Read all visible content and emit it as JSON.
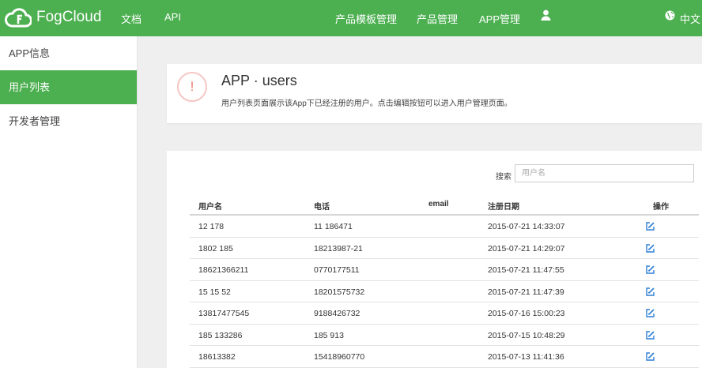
{
  "header": {
    "brand": "FogCloud",
    "nav_left": [
      "文档",
      "API"
    ],
    "nav_right": [
      "产品模板管理",
      "产品管理",
      "APP管理"
    ],
    "language": "中文",
    "accent_color": "#4caf50"
  },
  "sidebar": {
    "items": [
      {
        "label": "APP信息",
        "active": false
      },
      {
        "label": "用户列表",
        "active": true
      },
      {
        "label": "开发者管理",
        "active": false
      }
    ]
  },
  "info": {
    "icon": "!",
    "title": "APP · users",
    "description": "用户列表页面展示该App下已经注册的用户。点击编辑按钮可以进入用户管理页面。"
  },
  "table": {
    "search_label": "搜索",
    "search_placeholder": "用户名",
    "columns": [
      "用户名",
      "电话",
      "email",
      "注册日期",
      "操作"
    ],
    "rows": [
      {
        "username": "12 178",
        "phone": "11 186471",
        "email": "",
        "date": "2015-07-21 14:33:07"
      },
      {
        "username": "1802 185",
        "phone": "18213987-21",
        "email": "",
        "date": "2015-07-21 14:29:07"
      },
      {
        "username": "18621366211",
        "phone": "0770177511",
        "email": "",
        "date": "2015-07-21 11:47:55"
      },
      {
        "username": "15 15 52",
        "phone": "18201575732",
        "email": "",
        "date": "2015-07-21 11:47:39"
      },
      {
        "username": "13817477545",
        "phone": "9188426732",
        "email": "",
        "date": "2015-07-16 15:00:23"
      },
      {
        "username": "185 133286",
        "phone": "185 913",
        "email": "",
        "date": "2015-07-15 10:48:29"
      },
      {
        "username": "18613382",
        "phone": "15418960770",
        "email": "",
        "date": "2015-07-13 11:41:36"
      }
    ]
  }
}
